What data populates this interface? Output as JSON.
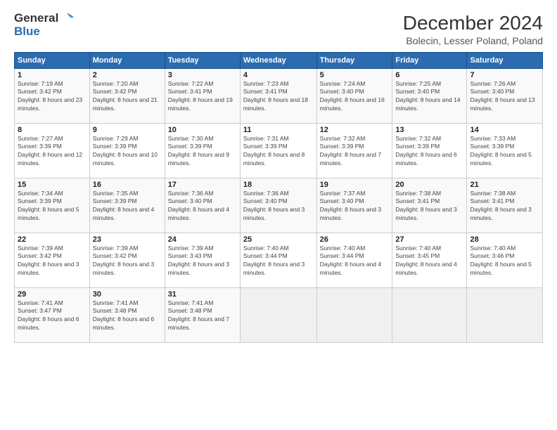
{
  "header": {
    "logo_line1": "General",
    "logo_line2": "Blue",
    "title": "December 2024",
    "subtitle": "Bolecin, Lesser Poland, Poland"
  },
  "weekdays": [
    "Sunday",
    "Monday",
    "Tuesday",
    "Wednesday",
    "Thursday",
    "Friday",
    "Saturday"
  ],
  "weeks": [
    [
      {
        "day": "1",
        "sunrise": "7:19 AM",
        "sunset": "3:42 PM",
        "daylight": "8 hours and 23 minutes."
      },
      {
        "day": "2",
        "sunrise": "7:20 AM",
        "sunset": "3:42 PM",
        "daylight": "8 hours and 21 minutes."
      },
      {
        "day": "3",
        "sunrise": "7:22 AM",
        "sunset": "3:41 PM",
        "daylight": "8 hours and 19 minutes."
      },
      {
        "day": "4",
        "sunrise": "7:23 AM",
        "sunset": "3:41 PM",
        "daylight": "8 hours and 18 minutes."
      },
      {
        "day": "5",
        "sunrise": "7:24 AM",
        "sunset": "3:40 PM",
        "daylight": "8 hours and 16 minutes."
      },
      {
        "day": "6",
        "sunrise": "7:25 AM",
        "sunset": "3:40 PM",
        "daylight": "8 hours and 14 minutes."
      },
      {
        "day": "7",
        "sunrise": "7:26 AM",
        "sunset": "3:40 PM",
        "daylight": "8 hours and 13 minutes."
      }
    ],
    [
      {
        "day": "8",
        "sunrise": "7:27 AM",
        "sunset": "3:39 PM",
        "daylight": "8 hours and 12 minutes."
      },
      {
        "day": "9",
        "sunrise": "7:29 AM",
        "sunset": "3:39 PM",
        "daylight": "8 hours and 10 minutes."
      },
      {
        "day": "10",
        "sunrise": "7:30 AM",
        "sunset": "3:39 PM",
        "daylight": "8 hours and 9 minutes."
      },
      {
        "day": "11",
        "sunrise": "7:31 AM",
        "sunset": "3:39 PM",
        "daylight": "8 hours and 8 minutes."
      },
      {
        "day": "12",
        "sunrise": "7:32 AM",
        "sunset": "3:39 PM",
        "daylight": "8 hours and 7 minutes."
      },
      {
        "day": "13",
        "sunrise": "7:32 AM",
        "sunset": "3:39 PM",
        "daylight": "8 hours and 6 minutes."
      },
      {
        "day": "14",
        "sunrise": "7:33 AM",
        "sunset": "3:39 PM",
        "daylight": "8 hours and 5 minutes."
      }
    ],
    [
      {
        "day": "15",
        "sunrise": "7:34 AM",
        "sunset": "3:39 PM",
        "daylight": "8 hours and 5 minutes."
      },
      {
        "day": "16",
        "sunrise": "7:35 AM",
        "sunset": "3:39 PM",
        "daylight": "8 hours and 4 minutes."
      },
      {
        "day": "17",
        "sunrise": "7:36 AM",
        "sunset": "3:40 PM",
        "daylight": "8 hours and 4 minutes."
      },
      {
        "day": "18",
        "sunrise": "7:36 AM",
        "sunset": "3:40 PM",
        "daylight": "8 hours and 3 minutes."
      },
      {
        "day": "19",
        "sunrise": "7:37 AM",
        "sunset": "3:40 PM",
        "daylight": "8 hours and 3 minutes."
      },
      {
        "day": "20",
        "sunrise": "7:38 AM",
        "sunset": "3:41 PM",
        "daylight": "8 hours and 3 minutes."
      },
      {
        "day": "21",
        "sunrise": "7:38 AM",
        "sunset": "3:41 PM",
        "daylight": "8 hours and 3 minutes."
      }
    ],
    [
      {
        "day": "22",
        "sunrise": "7:39 AM",
        "sunset": "3:42 PM",
        "daylight": "8 hours and 3 minutes."
      },
      {
        "day": "23",
        "sunrise": "7:39 AM",
        "sunset": "3:42 PM",
        "daylight": "8 hours and 3 minutes."
      },
      {
        "day": "24",
        "sunrise": "7:39 AM",
        "sunset": "3:43 PM",
        "daylight": "8 hours and 3 minutes."
      },
      {
        "day": "25",
        "sunrise": "7:40 AM",
        "sunset": "3:44 PM",
        "daylight": "8 hours and 3 minutes."
      },
      {
        "day": "26",
        "sunrise": "7:40 AM",
        "sunset": "3:44 PM",
        "daylight": "8 hours and 4 minutes."
      },
      {
        "day": "27",
        "sunrise": "7:40 AM",
        "sunset": "3:45 PM",
        "daylight": "8 hours and 4 minutes."
      },
      {
        "day": "28",
        "sunrise": "7:40 AM",
        "sunset": "3:46 PM",
        "daylight": "8 hours and 5 minutes."
      }
    ],
    [
      {
        "day": "29",
        "sunrise": "7:41 AM",
        "sunset": "3:47 PM",
        "daylight": "8 hours and 6 minutes."
      },
      {
        "day": "30",
        "sunrise": "7:41 AM",
        "sunset": "3:48 PM",
        "daylight": "8 hours and 6 minutes."
      },
      {
        "day": "31",
        "sunrise": "7:41 AM",
        "sunset": "3:48 PM",
        "daylight": "8 hours and 7 minutes."
      },
      null,
      null,
      null,
      null
    ]
  ],
  "labels": {
    "sunrise": "Sunrise:",
    "sunset": "Sunset:",
    "daylight": "Daylight:"
  }
}
